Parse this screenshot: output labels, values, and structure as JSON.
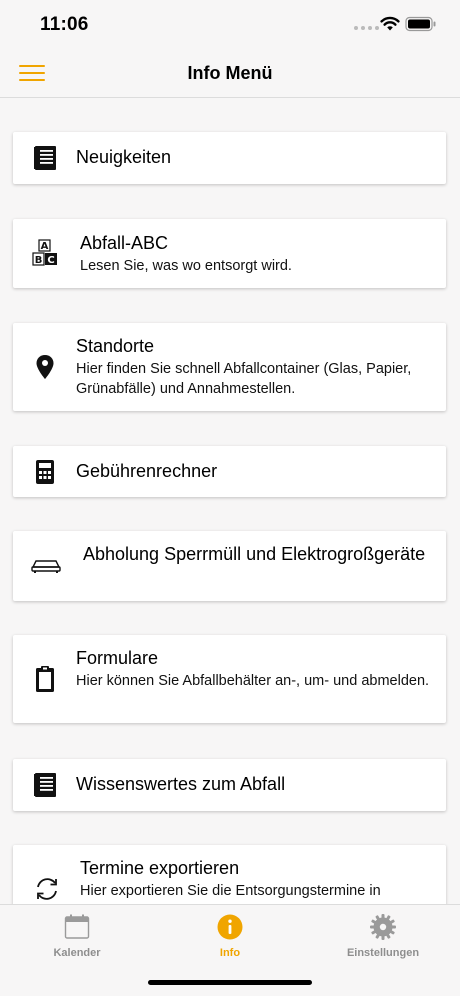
{
  "status": {
    "time": "11:06"
  },
  "header": {
    "title": "Info Menü"
  },
  "items": [
    {
      "title": "Neuigkeiten",
      "subtitle": "",
      "icon": "news-book-icon"
    },
    {
      "title": "Abfall-ABC",
      "subtitle": "Lesen Sie, was wo entsorgt wird.",
      "icon": "abc-blocks-icon"
    },
    {
      "title": "Standorte",
      "subtitle": "Hier finden Sie schnell Abfallcontainer (Glas, Papier, Grünabfälle) und Annahmestellen.",
      "icon": "location-pin-icon"
    },
    {
      "title": "Gebührenrechner",
      "subtitle": "",
      "icon": "calculator-icon"
    },
    {
      "title": "Abholung Sperrmüll und Elektrogroßgeräte",
      "subtitle": "",
      "icon": "sofa-icon"
    },
    {
      "title": "Formulare",
      "subtitle": "Hier können Sie Abfallbehälter an-, um- und abmelden.",
      "icon": "clipboard-icon"
    },
    {
      "title": "Wissenswertes zum Abfall",
      "subtitle": "",
      "icon": "book-icon"
    },
    {
      "title": "Termine exportieren",
      "subtitle": "Hier exportieren Sie die Entsorgungstermine in",
      "icon": "sync-icon"
    }
  ],
  "tabs": [
    {
      "label": "Kalender",
      "icon": "calendar-icon"
    },
    {
      "label": "Info",
      "icon": "info-icon"
    },
    {
      "label": "Einstellungen",
      "icon": "gear-icon"
    }
  ],
  "colors": {
    "accent": "#f0a500",
    "inactive": "#8e8e8e",
    "background": "#f7f6f6"
  }
}
